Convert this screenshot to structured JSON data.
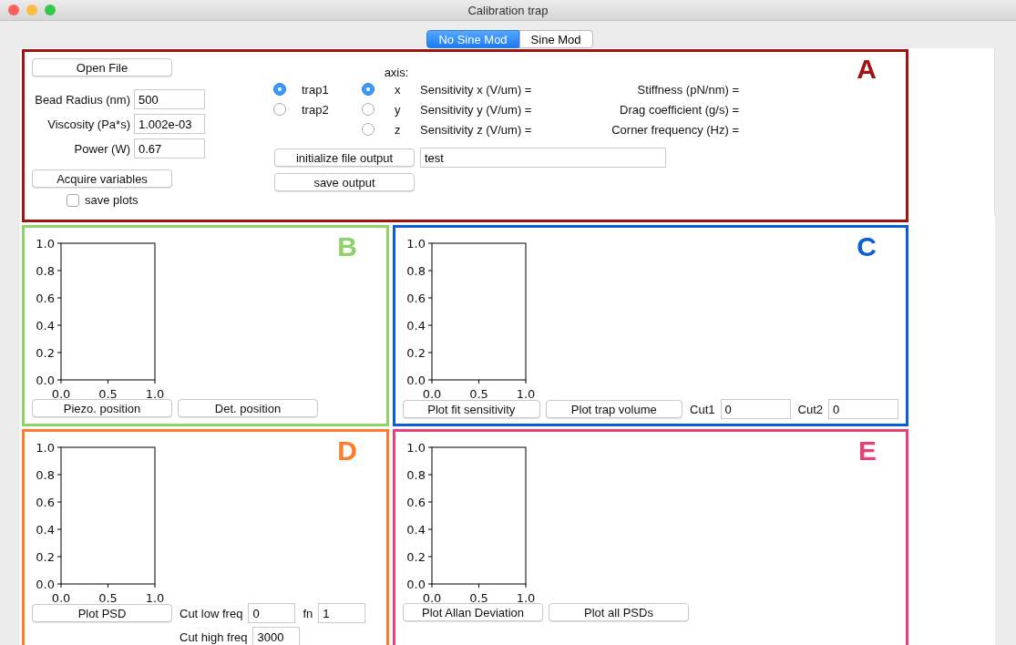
{
  "window": {
    "title": "Calibration trap"
  },
  "tabs": [
    {
      "label": "No Sine Mod",
      "selected": true
    },
    {
      "label": "Sine Mod",
      "selected": false
    }
  ],
  "panel_a": {
    "letter": "A",
    "color": "#a01313",
    "open_file_button": "Open File",
    "fields": [
      {
        "label": "Bead Radius (nm)",
        "value": "500"
      },
      {
        "label": "Viscosity (Pa*s)",
        "value": "1.002e-03"
      },
      {
        "label": "Power (W)",
        "value": "0.67"
      }
    ],
    "acquire_button": "Acquire variables",
    "save_plots": {
      "label": "save plots",
      "checked": false
    },
    "axis_header": "axis:",
    "traps": [
      {
        "label": "trap1",
        "selected": true
      },
      {
        "label": "trap2",
        "selected": false
      }
    ],
    "axes": [
      {
        "label": "x",
        "selected": true
      },
      {
        "label": "y",
        "selected": false
      },
      {
        "label": "z",
        "selected": false
      }
    ],
    "sensitivities": [
      "Sensitivity x (V/um) =",
      "Sensitivity y (V/um) =",
      "Sensitivity z (V/um) ="
    ],
    "results": [
      "Stiffness (pN/nm) =",
      "Drag coefficient (g/s) =",
      "Corner frequency (Hz) ="
    ],
    "init_button": "initialize file output",
    "output_field": {
      "value": "test"
    },
    "save_output_button": "save output"
  },
  "plot_panels": [
    {
      "letter": "B",
      "color": "#8fd16b",
      "chart_data": {
        "type": "line",
        "xlim": [
          0,
          1
        ],
        "ylim": [
          0,
          1
        ],
        "xticks": [
          {
            "value": 0,
            "label": "0.0"
          },
          {
            "value": 0.5,
            "label": "0.5"
          },
          {
            "value": 1,
            "label": "1.0"
          }
        ],
        "yticks": [
          {
            "value": 0,
            "label": "0.0"
          },
          {
            "value": 0.2,
            "label": "0.2"
          },
          {
            "value": 0.4,
            "label": "0.4"
          },
          {
            "value": 0.6,
            "label": "0.6"
          },
          {
            "value": 0.8,
            "label": "0.8"
          },
          {
            "value": 1,
            "label": "1.0"
          }
        ]
      },
      "rows": [
        [
          {
            "kind": "button",
            "text": "Piezo. position"
          },
          {
            "kind": "button",
            "text": "Det. position"
          }
        ]
      ]
    },
    {
      "letter": "C",
      "color": "#0b5fd6",
      "chart_data": {
        "type": "line",
        "xlim": [
          0,
          1
        ],
        "ylim": [
          0,
          1
        ],
        "xticks": [
          {
            "value": 0,
            "label": "0.0"
          },
          {
            "value": 0.5,
            "label": "0.5"
          },
          {
            "value": 1,
            "label": "1.0"
          }
        ],
        "yticks": [
          {
            "value": 0,
            "label": "0.0"
          },
          {
            "value": 0.2,
            "label": "0.2"
          },
          {
            "value": 0.4,
            "label": "0.4"
          },
          {
            "value": 0.6,
            "label": "0.6"
          },
          {
            "value": 0.8,
            "label": "0.8"
          },
          {
            "value": 1,
            "label": "1.0"
          }
        ]
      },
      "rows": [
        [
          {
            "kind": "button",
            "text": "Plot fit sensitivity"
          },
          {
            "kind": "button",
            "text": "Plot trap volume"
          },
          {
            "kind": "label",
            "text": "Cut1"
          },
          {
            "kind": "field",
            "text": "0"
          },
          {
            "kind": "label",
            "text": "Cut2"
          },
          {
            "kind": "field",
            "text": "0"
          }
        ]
      ]
    },
    {
      "letter": "D",
      "color": "#ff7a2a",
      "chart_data": {
        "type": "line",
        "xlim": [
          0,
          1
        ],
        "ylim": [
          0,
          1
        ],
        "xticks": [
          {
            "value": 0,
            "label": "0.0"
          },
          {
            "value": 0.5,
            "label": "0.5"
          },
          {
            "value": 1,
            "label": "1.0"
          }
        ],
        "yticks": [
          {
            "value": 0,
            "label": "0.0"
          },
          {
            "value": 0.2,
            "label": "0.2"
          },
          {
            "value": 0.4,
            "label": "0.4"
          },
          {
            "value": 0.6,
            "label": "0.6"
          },
          {
            "value": 0.8,
            "label": "0.8"
          },
          {
            "value": 1,
            "label": "1.0"
          }
        ]
      },
      "rows": [
        [
          {
            "kind": "button",
            "text": "Plot PSD"
          },
          {
            "kind": "label",
            "text": "Cut low freq"
          },
          {
            "kind": "field",
            "text": "0"
          },
          {
            "kind": "label",
            "text": "fn"
          },
          {
            "kind": "field",
            "text": "1"
          }
        ],
        [
          {
            "kind": "spacer"
          },
          {
            "kind": "label",
            "text": "Cut high freq"
          },
          {
            "kind": "field",
            "text": "3000"
          }
        ]
      ]
    },
    {
      "letter": "E",
      "color": "#e8407a",
      "chart_data": {
        "type": "line",
        "xlim": [
          0,
          1
        ],
        "ylim": [
          0,
          1
        ],
        "xticks": [
          {
            "value": 0,
            "label": "0.0"
          },
          {
            "value": 0.5,
            "label": "0.5"
          },
          {
            "value": 1,
            "label": "1.0"
          }
        ],
        "yticks": [
          {
            "value": 0,
            "label": "0.0"
          },
          {
            "value": 0.2,
            "label": "0.2"
          },
          {
            "value": 0.4,
            "label": "0.4"
          },
          {
            "value": 0.6,
            "label": "0.6"
          },
          {
            "value": 0.8,
            "label": "0.8"
          },
          {
            "value": 1,
            "label": "1.0"
          }
        ]
      },
      "rows": [
        [
          {
            "kind": "button",
            "text": "Plot Allan Deviation"
          },
          {
            "kind": "button",
            "text": "Plot all PSDs"
          }
        ]
      ]
    }
  ]
}
